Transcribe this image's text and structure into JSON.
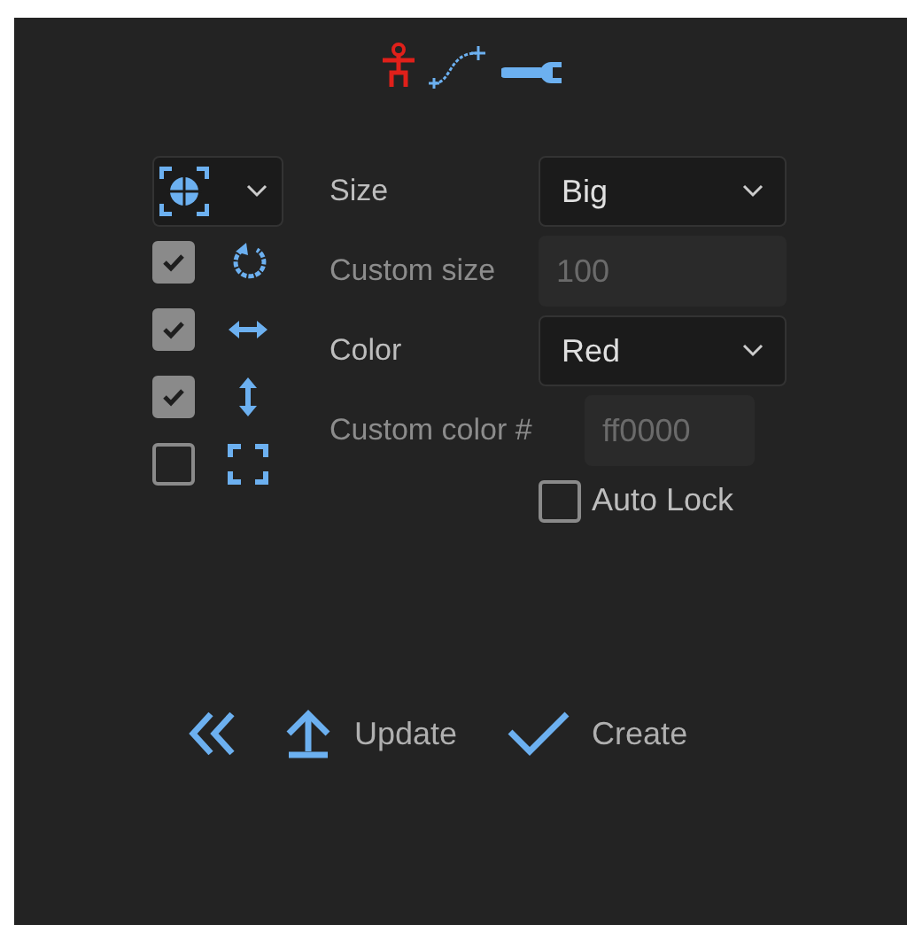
{
  "toggles": [
    {
      "kind": "rotate",
      "checked": true
    },
    {
      "kind": "horizontal",
      "checked": true
    },
    {
      "kind": "vertical",
      "checked": true
    },
    {
      "kind": "scale",
      "checked": false
    }
  ],
  "fields": [
    {
      "kind": "select",
      "label": "Size",
      "value": "Big"
    },
    {
      "kind": "input",
      "label": "Custom size",
      "placeholder": "100"
    },
    {
      "kind": "select",
      "label": "Color",
      "value": "Red"
    },
    {
      "kind": "input",
      "label": "Custom color #",
      "placeholder": "ff0000"
    }
  ],
  "auto_lock": {
    "label": "Auto Lock",
    "checked": false
  },
  "actions": [
    {
      "kind": "back"
    },
    {
      "kind": "update",
      "label": "Update"
    },
    {
      "kind": "create",
      "label": "Create"
    }
  ]
}
